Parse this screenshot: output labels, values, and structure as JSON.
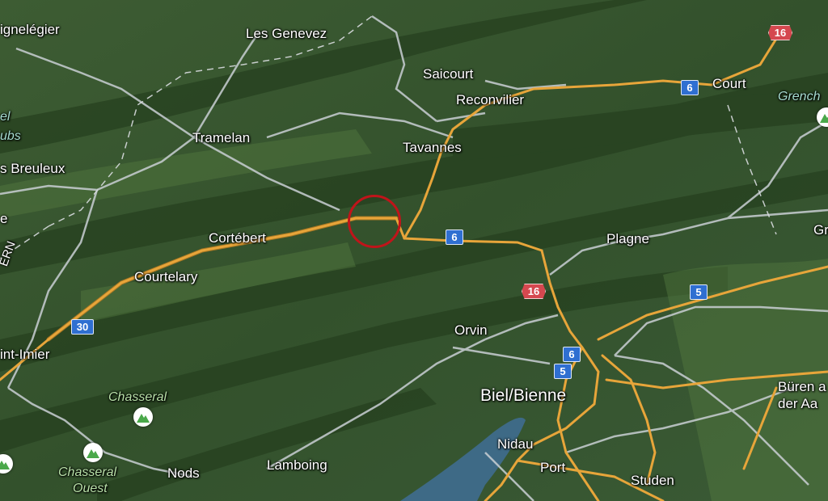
{
  "map": {
    "places": {
      "saignelegier": "ignelégier",
      "les_genevez": "Les Genevez",
      "saicourt": "Saicourt",
      "reconvilier": "Reconvilier",
      "court": "Court",
      "tramelan": "Tramelan",
      "tavannes": "Tavannes",
      "les_breuleux": "s Breuleux",
      "cortebert": "Cortébert",
      "plagne": "Plagne",
      "courtelary": "Courtelary",
      "orvin": "Orvin",
      "st_imier": "int-Imier",
      "biel": "Biel/Bienne",
      "buren": "Büren a",
      "buren2": "der Aa",
      "nidau": "Nidau",
      "nods": "Nods",
      "lamboing": "Lamboing",
      "port": "Port",
      "studen": "Studen",
      "grenchen": "Grench",
      "gr_edge": "Gr",
      "el_edge": "el",
      "ubs_edge": "ubs",
      "ern_edge": "ERN",
      "e_edge": "e"
    },
    "parks": {
      "chasseral": "Chasseral",
      "chasseral_ouest_1": "Chasseral",
      "chasseral_ouest_2": "Ouest"
    },
    "shields": {
      "r16_top": "16",
      "r6_court": "6",
      "r6_mid": "6",
      "r16_mid": "16",
      "r5_right": "5",
      "r30": "30",
      "r6_biel": "6",
      "r5_biel": "5"
    },
    "icons": {
      "mountain_poi": "mountain-icon",
      "location_marker": "circle-marker"
    },
    "colors": {
      "road_major": "#e7a53a",
      "road_minor": "#c9cfd4",
      "border": "#d8dcdf",
      "lake": "#3e6a86",
      "marker": "#c0141a",
      "shield_blue": "#2f6fd1",
      "shield_red": "#d5484f"
    }
  }
}
